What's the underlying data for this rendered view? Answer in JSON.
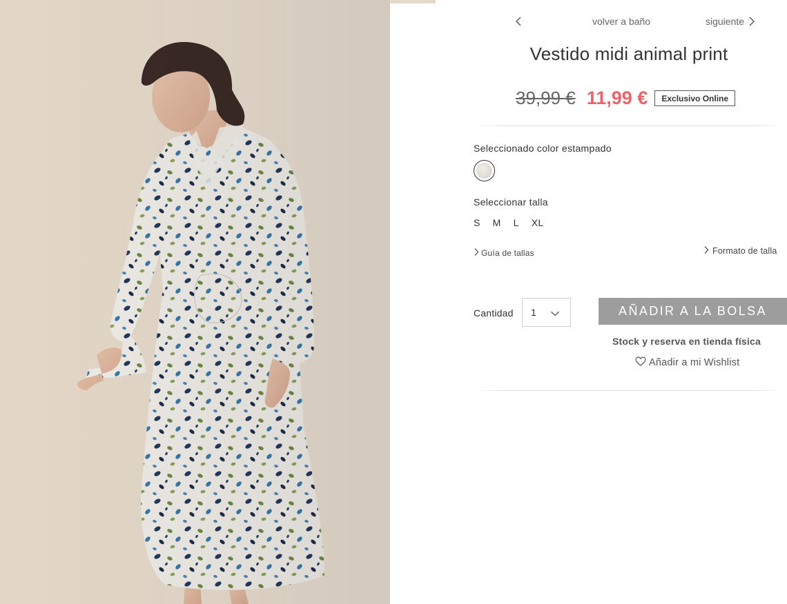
{
  "product_image": {
    "alt": "Vestido midi animal print"
  },
  "nav": {
    "back_label": "volver a baño",
    "next_label": "siguiente"
  },
  "product": {
    "title": "Vestido midi animal print",
    "old_price": "39,99 €",
    "new_price": "11,99 €",
    "badge": "Exclusivo Online",
    "price_color": "#e8636b"
  },
  "color": {
    "label": "Seleccionado color estampado"
  },
  "size": {
    "label": "Seleccionar talla",
    "options": [
      "S",
      "M",
      "L",
      "XL"
    ],
    "guide_label": "Guía de tallas",
    "format_label": "Formato de talla"
  },
  "purchase": {
    "quantity_label": "Cantidad",
    "quantity_value": "1",
    "add_button_label": "AÑADIR A LA BOLSA",
    "add_button_color": "#9d9d9d",
    "stock_label": "Stock y reserva en tienda física",
    "wishlist_label": "Añadir a mi Wishlist"
  },
  "icons": {
    "prev": "chevron-left-icon",
    "next": "chevron-right-icon",
    "dropdown": "chevron-down-icon",
    "wishlist": "heart-icon"
  }
}
